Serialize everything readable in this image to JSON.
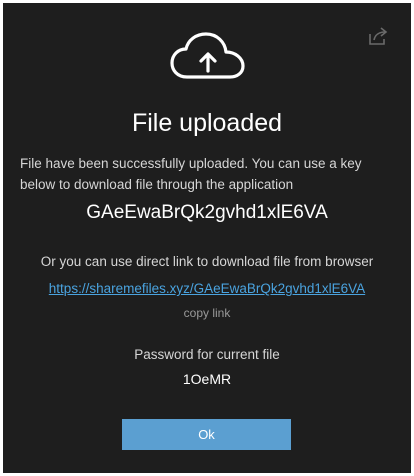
{
  "icons": {
    "upload": "cloud-upload-icon",
    "share": "share-icon"
  },
  "dialog": {
    "title": "File uploaded",
    "message": "File have been successfully uploaded. You can use a key below to download file through the application",
    "key": "GAeEwaBrQk2gvhd1xlE6VA",
    "alt_text": "Or you can use direct link to download file from browser",
    "link": "https://sharemefiles.xyz/GAeEwaBrQk2gvhd1xlE6VA",
    "copy_link": "copy link",
    "password_label": "Password for current file",
    "password_value": "1OeMR",
    "ok_label": "Ok"
  },
  "colors": {
    "background": "#1e1e1e",
    "link": "#4aa3df",
    "button": "#5b9fd1"
  }
}
